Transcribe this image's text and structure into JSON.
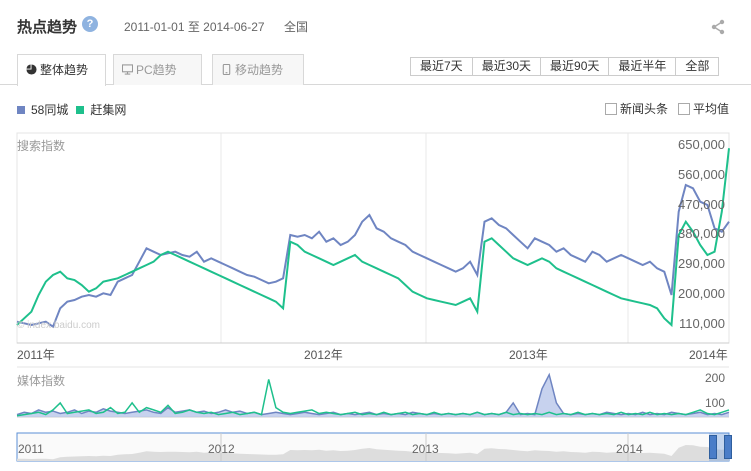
{
  "header": {
    "title": "热点趋势",
    "help_icon": "?",
    "date_range": "2011-01-01 至 2014-06-27",
    "region": "全国"
  },
  "tabs": [
    {
      "label": "整体趋势",
      "icon": "pie-icon",
      "active": true
    },
    {
      "label": "PC趋势",
      "icon": "monitor-icon",
      "active": false
    },
    {
      "label": "移动趋势",
      "icon": "phone-icon",
      "active": false
    }
  ],
  "range_buttons": [
    "最近7天",
    "最近30天",
    "最近90天",
    "最近半年",
    "全部"
  ],
  "legend": [
    {
      "name": "58同城",
      "color": "#6f85c2"
    },
    {
      "name": "赶集网",
      "color": "#1ec08c"
    }
  ],
  "options": [
    {
      "label": "新闻头条",
      "checked": false
    },
    {
      "label": "平均值",
      "checked": false
    }
  ],
  "main_chart_label": "搜索指数",
  "media_chart_label": "媒体指数",
  "watermark": "© index.baidu.com",
  "chart_data": [
    {
      "type": "line",
      "title": "搜索指数",
      "y_ticks": [
        "650,000",
        "560,000",
        "470,000",
        "380,000",
        "290,000",
        "200,000",
        "110,000"
      ],
      "ylim": [
        110000,
        650000
      ],
      "x_ticks": [
        "2011年",
        "2012年",
        "2013年",
        "2014年"
      ],
      "x_range": [
        "2011-01-01",
        "2014-06-27"
      ],
      "series": [
        {
          "name": "58同城",
          "color": "#6f85c2",
          "values": [
            120000,
            115000,
            110000,
            115000,
            120000,
            105000,
            160000,
            180000,
            185000,
            195000,
            200000,
            195000,
            205000,
            200000,
            240000,
            250000,
            260000,
            300000,
            340000,
            330000,
            320000,
            325000,
            330000,
            320000,
            315000,
            330000,
            300000,
            310000,
            300000,
            290000,
            280000,
            270000,
            260000,
            255000,
            245000,
            235000,
            240000,
            250000,
            380000,
            375000,
            380000,
            370000,
            390000,
            360000,
            370000,
            350000,
            360000,
            380000,
            420000,
            440000,
            400000,
            390000,
            370000,
            360000,
            350000,
            330000,
            320000,
            310000,
            300000,
            290000,
            280000,
            270000,
            280000,
            300000,
            260000,
            420000,
            430000,
            410000,
            400000,
            380000,
            360000,
            340000,
            370000,
            360000,
            350000,
            330000,
            340000,
            320000,
            310000,
            300000,
            330000,
            320000,
            300000,
            310000,
            320000,
            310000,
            300000,
            290000,
            300000,
            280000,
            270000,
            200000,
            450000,
            530000,
            520000,
            480000,
            470000,
            400000,
            390000,
            420000
          ]
        },
        {
          "name": "赶集网",
          "color": "#1ec08c",
          "values": [
            110000,
            130000,
            150000,
            200000,
            240000,
            260000,
            270000,
            250000,
            245000,
            230000,
            210000,
            220000,
            240000,
            245000,
            250000,
            260000,
            270000,
            280000,
            290000,
            300000,
            320000,
            330000,
            320000,
            310000,
            300000,
            290000,
            280000,
            270000,
            260000,
            250000,
            240000,
            230000,
            220000,
            210000,
            200000,
            190000,
            180000,
            160000,
            360000,
            350000,
            330000,
            320000,
            310000,
            300000,
            290000,
            300000,
            310000,
            320000,
            300000,
            290000,
            280000,
            270000,
            260000,
            250000,
            230000,
            210000,
            200000,
            190000,
            185000,
            180000,
            175000,
            170000,
            180000,
            190000,
            150000,
            360000,
            370000,
            350000,
            330000,
            310000,
            300000,
            290000,
            300000,
            310000,
            300000,
            280000,
            270000,
            260000,
            250000,
            240000,
            230000,
            220000,
            210000,
            200000,
            190000,
            185000,
            180000,
            175000,
            170000,
            160000,
            130000,
            110000,
            380000,
            420000,
            390000,
            350000,
            320000,
            330000,
            450000,
            640000
          ]
        }
      ]
    },
    {
      "type": "line",
      "title": "媒体指数",
      "y_ticks": [
        "200",
        "100"
      ],
      "ylim": [
        0,
        200
      ],
      "series": [
        {
          "name": "58同城",
          "color": "#6f85c2",
          "values": [
            10,
            20,
            15,
            30,
            20,
            25,
            15,
            20,
            30,
            15,
            25,
            20,
            35,
            25,
            20,
            15,
            20,
            25,
            30,
            20,
            15,
            40,
            20,
            25,
            30,
            20,
            25,
            15,
            20,
            30,
            20,
            25,
            15,
            20,
            10,
            15,
            20,
            15,
            10,
            15,
            20,
            15,
            10,
            15,
            20,
            10,
            15,
            10,
            15,
            20,
            10,
            15,
            10,
            15,
            10,
            20,
            15,
            10,
            15,
            10,
            15,
            10,
            15,
            10,
            20,
            10,
            15,
            10,
            20,
            60,
            10,
            15,
            10,
            120,
            180,
            60,
            15,
            10,
            15,
            10,
            15,
            10,
            20,
            15,
            10,
            15,
            10,
            20,
            10,
            15,
            10,
            20,
            15,
            10,
            15,
            20,
            10,
            15,
            10,
            20
          ]
        },
        {
          "name": "赶集网",
          "color": "#1ec08c",
          "values": [
            5,
            10,
            15,
            20,
            10,
            30,
            60,
            15,
            20,
            25,
            30,
            15,
            20,
            40,
            15,
            20,
            60,
            20,
            40,
            30,
            20,
            50,
            15,
            20,
            30,
            20,
            15,
            20,
            10,
            15,
            20,
            10,
            15,
            20,
            10,
            160,
            40,
            20,
            15,
            20,
            25,
            30,
            15,
            20,
            15,
            10,
            15,
            20,
            10,
            15,
            10,
            20,
            10,
            15,
            20,
            10,
            15,
            10,
            20,
            10,
            15,
            10,
            15,
            10,
            20,
            10,
            15,
            10,
            20,
            10,
            15,
            10,
            15,
            10,
            20,
            10,
            15,
            10,
            20,
            10,
            15,
            10,
            15,
            10,
            20,
            10,
            15,
            10,
            20,
            10,
            15,
            10,
            15,
            10,
            20,
            30,
            15,
            10,
            20,
            30
          ]
        }
      ]
    }
  ],
  "navigator": {
    "labels": [
      "2011",
      "2012",
      "2013",
      "2014"
    ]
  }
}
